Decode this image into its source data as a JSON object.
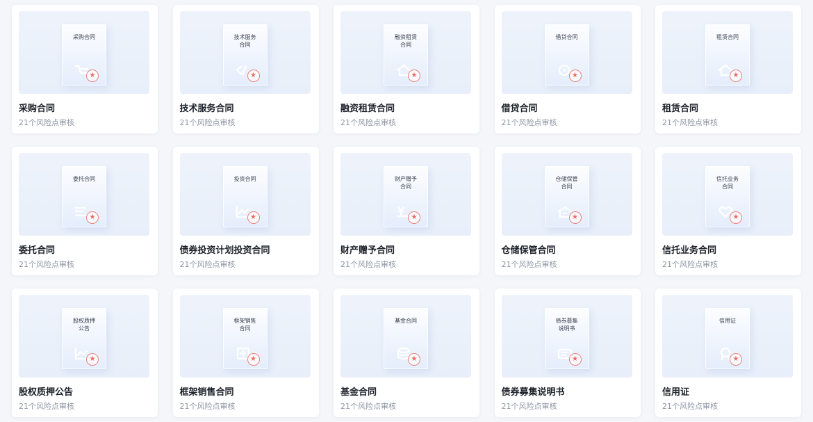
{
  "accent_color": "#f08078",
  "cards": [
    {
      "doc_title": "采购合同",
      "title": "采购合同",
      "subtitle": "21个风险点审核",
      "icon": "cart-icon"
    },
    {
      "doc_title": "技术服务\n合同",
      "title": "技术服务合同",
      "subtitle": "21个风险点审核",
      "icon": "code-icon"
    },
    {
      "doc_title": "融资租赁\n合同",
      "title": "融资租赁合同",
      "subtitle": "21个风险点审核",
      "icon": "house-icon"
    },
    {
      "doc_title": "借贷合同",
      "title": "借贷合同",
      "subtitle": "21个风险点审核",
      "icon": "coin-icon"
    },
    {
      "doc_title": "租赁合同",
      "title": "租赁合同",
      "subtitle": "21个风险点审核",
      "icon": "house-icon"
    },
    {
      "doc_title": "委托合同",
      "title": "委托合同",
      "subtitle": "21个风险点审核",
      "icon": "hand-icon"
    },
    {
      "doc_title": "投资合同",
      "title": "债券投资计划投资合同",
      "subtitle": "21个风险点审核",
      "icon": "chart-line-icon"
    },
    {
      "doc_title": "财产赠予\n合同",
      "title": "财产赠予合同",
      "subtitle": "21个风险点审核",
      "icon": "yuan-hand-icon"
    },
    {
      "doc_title": "仓储保管\n合同",
      "title": "仓储保管合同",
      "subtitle": "21个风险点审核",
      "icon": "warehouse-icon"
    },
    {
      "doc_title": "信托业务\n合同",
      "title": "信托业务合同",
      "subtitle": "21个风险点审核",
      "icon": "heart-icon"
    },
    {
      "doc_title": "股权质押\n公告",
      "title": "股权质押公告",
      "subtitle": "21个风险点审核",
      "icon": "chart-line-icon"
    },
    {
      "doc_title": "框架销售\n合同",
      "title": "框架销售合同",
      "subtitle": "21个风险点审核",
      "icon": "document-icon"
    },
    {
      "doc_title": "基金合同",
      "title": "基金合同",
      "subtitle": "21个风险点审核",
      "icon": "database-icon"
    },
    {
      "doc_title": "债券募集\n说明书",
      "title": "债券募集说明书",
      "subtitle": "21个风险点审核",
      "icon": "ticket-icon"
    },
    {
      "doc_title": "信用证",
      "title": "信用证",
      "subtitle": "21个风险点审核",
      "icon": "badge-icon"
    }
  ]
}
